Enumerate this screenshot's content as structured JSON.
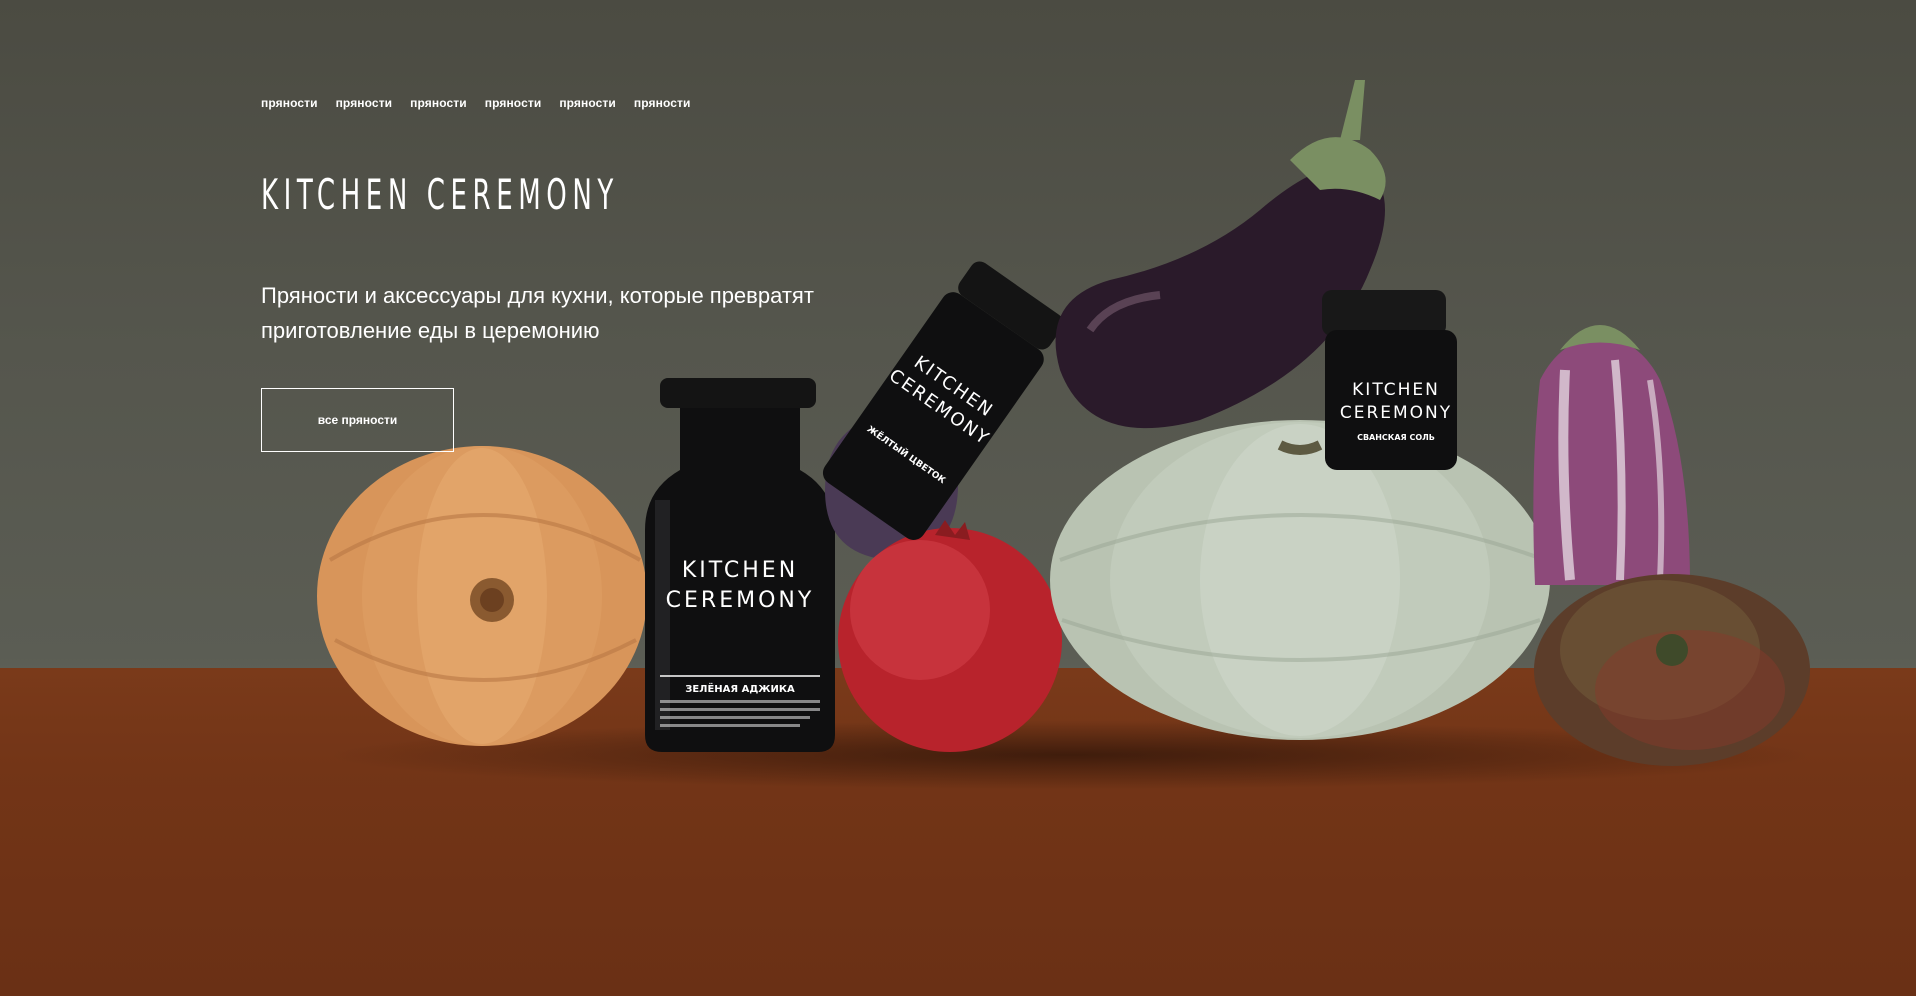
{
  "nav": {
    "items": [
      {
        "label": "пряности"
      },
      {
        "label": "пряности"
      },
      {
        "label": "пряности"
      },
      {
        "label": "пряности"
      },
      {
        "label": "пряности"
      },
      {
        "label": "пряности"
      }
    ]
  },
  "hero": {
    "brand": "KITCHEN CEREMONY",
    "tagline": "Пряности и аксессуары для кухни, которые превратят приготовление еды в церемонию",
    "cta_label": "все пряности"
  },
  "products": {
    "tall_jar": {
      "brand_line1": "KITCHEN",
      "brand_line2": "CEREMONY",
      "label": "ЗЕЛЁНАЯ АДЖИКА"
    },
    "tilted_jar": {
      "brand_line1": "KITCHEN",
      "brand_line2": "CEREMONY",
      "label": "ЖЁЛТЫЙ ЦВЕТОК"
    },
    "small_jar": {
      "brand_line1": "KITCHEN",
      "brand_line2": "CEREMONY",
      "label": "СВАНСКАЯ СОЛЬ"
    }
  },
  "colors": {
    "wall": "#4b4b42",
    "table": "#7a3a1a",
    "text": "#ffffff"
  }
}
